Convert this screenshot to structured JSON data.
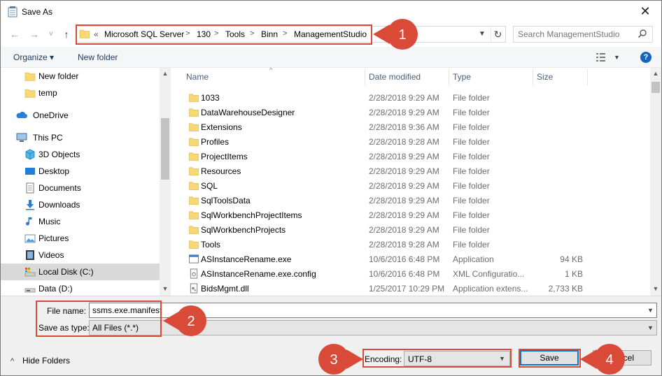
{
  "window": {
    "title": "Save As",
    "close_glyph": "✕"
  },
  "nav": {
    "back_glyph": "←",
    "forward_glyph": "→",
    "recent_glyph": "˅",
    "up_glyph": "↑",
    "overflow_glyph": "«",
    "breadcrumbs": [
      "Microsoft SQL Server",
      "130",
      "Tools",
      "Binn",
      "ManagementStudio"
    ],
    "search_placeholder": "Search ManagementStudio"
  },
  "toolbar": {
    "organize_label": "Organize ▾",
    "new_folder_label": "New folder"
  },
  "sidebar": {
    "items": [
      {
        "label": "New folder",
        "icon": "folder-icon",
        "indent": 1
      },
      {
        "label": "temp",
        "icon": "folder-icon",
        "indent": 1
      },
      {
        "label": "OneDrive",
        "icon": "onedrive-icon",
        "indent": 0
      },
      {
        "label": "This PC",
        "icon": "pc-icon",
        "indent": 0
      },
      {
        "label": "3D Objects",
        "icon": "cube-icon",
        "indent": 1
      },
      {
        "label": "Desktop",
        "icon": "desktop-icon",
        "indent": 1
      },
      {
        "label": "Documents",
        "icon": "documents-icon",
        "indent": 1
      },
      {
        "label": "Downloads",
        "icon": "downloads-icon",
        "indent": 1
      },
      {
        "label": "Music",
        "icon": "music-icon",
        "indent": 1
      },
      {
        "label": "Pictures",
        "icon": "pictures-icon",
        "indent": 1
      },
      {
        "label": "Videos",
        "icon": "videos-icon",
        "indent": 1
      },
      {
        "label": "Local Disk (C:)",
        "icon": "drive-c-icon",
        "indent": 1,
        "selected": true
      },
      {
        "label": "Data (D:)",
        "icon": "drive-d-icon",
        "indent": 1
      }
    ]
  },
  "filelist": {
    "columns": [
      "Name",
      "Date modified",
      "Type",
      "Size"
    ],
    "rows": [
      {
        "name": "1033",
        "date": "2/28/2018 9:29 AM",
        "type": "File folder",
        "size": "",
        "icon": "folder-icon"
      },
      {
        "name": "DataWarehouseDesigner",
        "date": "2/28/2018 9:29 AM",
        "type": "File folder",
        "size": "",
        "icon": "folder-icon"
      },
      {
        "name": "Extensions",
        "date": "2/28/2018 9:36 AM",
        "type": "File folder",
        "size": "",
        "icon": "folder-icon"
      },
      {
        "name": "Profiles",
        "date": "2/28/2018 9:28 AM",
        "type": "File folder",
        "size": "",
        "icon": "folder-icon"
      },
      {
        "name": "ProjectItems",
        "date": "2/28/2018 9:29 AM",
        "type": "File folder",
        "size": "",
        "icon": "folder-icon"
      },
      {
        "name": "Resources",
        "date": "2/28/2018 9:29 AM",
        "type": "File folder",
        "size": "",
        "icon": "folder-icon"
      },
      {
        "name": "SQL",
        "date": "2/28/2018 9:29 AM",
        "type": "File folder",
        "size": "",
        "icon": "folder-icon"
      },
      {
        "name": "SqlToolsData",
        "date": "2/28/2018 9:29 AM",
        "type": "File folder",
        "size": "",
        "icon": "folder-icon"
      },
      {
        "name": "SqlWorkbenchProjectItems",
        "date": "2/28/2018 9:29 AM",
        "type": "File folder",
        "size": "",
        "icon": "folder-icon"
      },
      {
        "name": "SqlWorkbenchProjects",
        "date": "2/28/2018 9:29 AM",
        "type": "File folder",
        "size": "",
        "icon": "folder-icon"
      },
      {
        "name": "Tools",
        "date": "2/28/2018 9:28 AM",
        "type": "File folder",
        "size": "",
        "icon": "folder-icon"
      },
      {
        "name": "ASInstanceRename.exe",
        "date": "10/6/2016 6:48 PM",
        "type": "Application",
        "size": "94 KB",
        "icon": "exe-icon"
      },
      {
        "name": "ASInstanceRename.exe.config",
        "date": "10/6/2016 6:48 PM",
        "type": "XML Configuratio...",
        "size": "1 KB",
        "icon": "config-icon"
      },
      {
        "name": "BidsMgmt.dll",
        "date": "1/25/2017 10:29 PM",
        "type": "Application extens...",
        "size": "2,733 KB",
        "icon": "dll-icon"
      }
    ]
  },
  "form": {
    "filename_label": "File name:",
    "filename_value": "ssms.exe.manifest",
    "savetype_label": "Save as type:",
    "savetype_value": "All Files  (*.*)",
    "encoding_label": "Encoding:",
    "encoding_value": "UTF-8",
    "save_label": "Save",
    "cancel_label": "ncel",
    "hide_folders_label": "Hide Folders",
    "hide_folders_glyph": "^"
  },
  "callouts": [
    "1",
    "2",
    "3",
    "4"
  ],
  "colors": {
    "callout": "#d94a38",
    "accent": "#0078d7",
    "folder": "#f8d775"
  }
}
